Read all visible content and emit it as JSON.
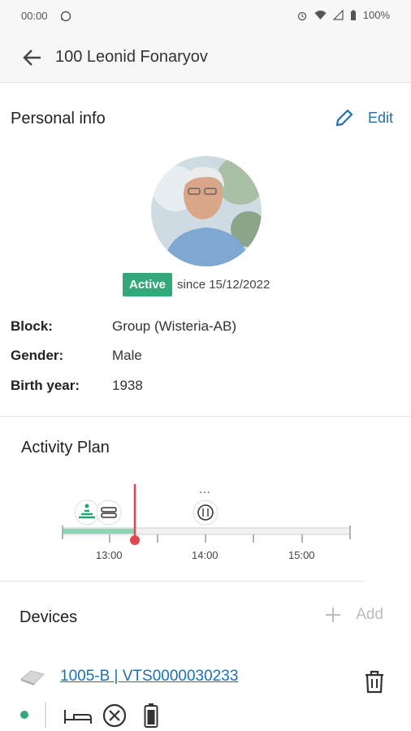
{
  "status_bar": {
    "time": "00:00",
    "battery": "100%"
  },
  "app_bar": {
    "title": "100 Leonid Fonaryov"
  },
  "personal_info": {
    "title": "Personal info",
    "edit_label": "Edit",
    "status": "Active",
    "since": "since 15/12/2022",
    "fields": [
      {
        "label": "Block:",
        "value": "Group (Wisteria-AB)"
      },
      {
        "label": "Gender:",
        "value": "Male"
      },
      {
        "label": "Birth year:",
        "value": "1938"
      }
    ]
  },
  "activity_plan": {
    "title": "Activity Plan",
    "ticks": [
      "13:00",
      "14:00",
      "15:00"
    ],
    "more": "...",
    "icons": [
      "exercise-icon",
      "dentures-icon",
      "meal-icon"
    ]
  },
  "devices": {
    "title": "Devices",
    "add_label": "Add",
    "items": [
      {
        "name": "1005-B | VTS0000030233"
      }
    ]
  },
  "colors": {
    "accent": "#1f6fb0",
    "active": "#34a87a",
    "now_line": "#e0474f",
    "timeline_fill": "#8fd3b5"
  }
}
